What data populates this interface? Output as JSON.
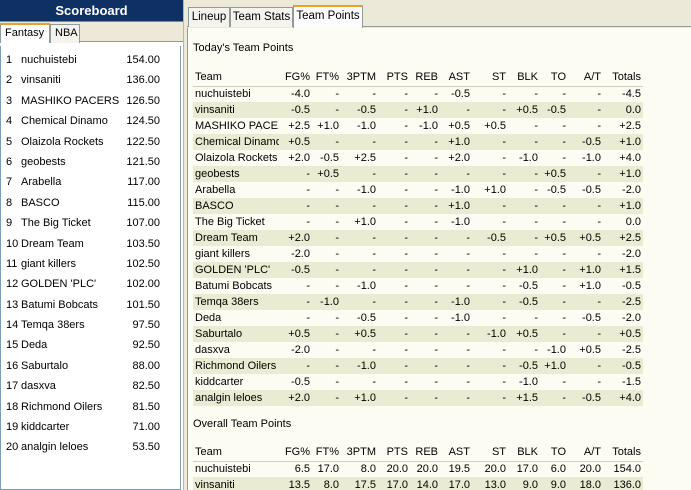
{
  "scoreboard": {
    "title": "Scoreboard",
    "tabs": [
      "Fantasy",
      "NBA"
    ],
    "rows": [
      {
        "rank": "1",
        "name": "nuchuistebi",
        "points": "154.00"
      },
      {
        "rank": "2",
        "name": "vinsaniti",
        "points": "136.00"
      },
      {
        "rank": "3",
        "name": "MASHIKO PACERS",
        "points": "126.50"
      },
      {
        "rank": "4",
        "name": "Chemical Dinamo",
        "points": "124.50"
      },
      {
        "rank": "5",
        "name": "Olaizola Rockets",
        "points": "122.50"
      },
      {
        "rank": "6",
        "name": "geobests",
        "points": "121.50"
      },
      {
        "rank": "7",
        "name": "Arabella",
        "points": "117.00"
      },
      {
        "rank": "8",
        "name": "BASCO",
        "points": "115.00"
      },
      {
        "rank": "9",
        "name": "The Big Ticket",
        "points": "107.00"
      },
      {
        "rank": "10",
        "name": "Dream Team",
        "points": "103.50"
      },
      {
        "rank": "11",
        "name": "giant killers",
        "points": "102.50"
      },
      {
        "rank": "12",
        "name": "GOLDEN 'PLC'",
        "points": "102.00"
      },
      {
        "rank": "13",
        "name": "Batumi Bobcats",
        "points": "101.50"
      },
      {
        "rank": "14",
        "name": "Temqa 38ers",
        "points": "97.50"
      },
      {
        "rank": "15",
        "name": "Deda",
        "points": "92.50"
      },
      {
        "rank": "16",
        "name": "Saburtalo",
        "points": "88.00"
      },
      {
        "rank": "17",
        "name": "dasxva",
        "points": "82.50"
      },
      {
        "rank": "18",
        "name": "Richmond Oilers",
        "points": "81.50"
      },
      {
        "rank": "19",
        "name": "kiddcarter",
        "points": "71.00"
      },
      {
        "rank": "20",
        "name": "analgin leloes",
        "points": "53.50"
      }
    ]
  },
  "main_tabs": {
    "lineup": "Lineup",
    "team_stats": "Team Stats",
    "team_points": "Team Points"
  },
  "today": {
    "title": "Today's Team Points",
    "headers": [
      "Team",
      "FG%",
      "FT%",
      "3PTM",
      "PTS",
      "REB",
      "AST",
      "ST",
      "BLK",
      "TO",
      "A/T",
      "Totals"
    ],
    "rows": [
      [
        "nuchuistebi",
        "-4.0",
        "-",
        "-",
        "-",
        "-",
        "-0.5",
        "-",
        "-",
        "-",
        "-",
        "-4.5"
      ],
      [
        "vinsaniti",
        "-0.5",
        "-",
        "-0.5",
        "-",
        "+1.0",
        "-",
        "-",
        "+0.5",
        "-0.5",
        "-",
        "0.0"
      ],
      [
        "MASHIKO PACE...",
        "+2.5",
        "+1.0",
        "-1.0",
        "-",
        "-1.0",
        "+0.5",
        "+0.5",
        "-",
        "-",
        "-",
        "+2.5"
      ],
      [
        "Chemical Dinamo",
        "+0.5",
        "-",
        "-",
        "-",
        "-",
        "+1.0",
        "-",
        "-",
        "-",
        "-0.5",
        "+1.0"
      ],
      [
        "Olaizola Rockets",
        "+2.0",
        "-0.5",
        "+2.5",
        "-",
        "-",
        "+2.0",
        "-",
        "-1.0",
        "-",
        "-1.0",
        "+4.0"
      ],
      [
        "geobests",
        "-",
        "+0.5",
        "-",
        "-",
        "-",
        "-",
        "-",
        "-",
        "+0.5",
        "-",
        "+1.0"
      ],
      [
        "Arabella",
        "-",
        "-",
        "-1.0",
        "-",
        "-",
        "-1.0",
        "+1.0",
        "-",
        "-0.5",
        "-0.5",
        "-2.0"
      ],
      [
        "BASCO",
        "-",
        "-",
        "-",
        "-",
        "-",
        "+1.0",
        "-",
        "-",
        "-",
        "-",
        "+1.0"
      ],
      [
        "The Big Ticket",
        "-",
        "-",
        "+1.0",
        "-",
        "-",
        "-1.0",
        "-",
        "-",
        "-",
        "-",
        "0.0"
      ],
      [
        "Dream Team",
        "+2.0",
        "-",
        "-",
        "-",
        "-",
        "-",
        "-0.5",
        "-",
        "+0.5",
        "+0.5",
        "+2.5"
      ],
      [
        "giant killers",
        "-2.0",
        "-",
        "-",
        "-",
        "-",
        "-",
        "-",
        "-",
        "-",
        "-",
        "-2.0"
      ],
      [
        "GOLDEN 'PLC'",
        "-0.5",
        "-",
        "-",
        "-",
        "-",
        "-",
        "-",
        "+1.0",
        "-",
        "+1.0",
        "+1.5"
      ],
      [
        "Batumi Bobcats",
        "-",
        "-",
        "-1.0",
        "-",
        "-",
        "-",
        "-",
        "-0.5",
        "-",
        "+1.0",
        "-0.5"
      ],
      [
        "Temqa 38ers",
        "-",
        "-1.0",
        "-",
        "-",
        "-",
        "-1.0",
        "-",
        "-0.5",
        "-",
        "-",
        "-2.5"
      ],
      [
        "Deda",
        "-",
        "-",
        "-0.5",
        "-",
        "-",
        "-1.0",
        "-",
        "-",
        "-",
        "-0.5",
        "-2.0"
      ],
      [
        "Saburtalo",
        "+0.5",
        "-",
        "+0.5",
        "-",
        "-",
        "-",
        "-1.0",
        "+0.5",
        "-",
        "-",
        "+0.5"
      ],
      [
        "dasxva",
        "-2.0",
        "-",
        "-",
        "-",
        "-",
        "-",
        "-",
        "-",
        "-1.0",
        "+0.5",
        "-2.5"
      ],
      [
        "Richmond Oilers",
        "-",
        "-",
        "-1.0",
        "-",
        "-",
        "-",
        "-",
        "-0.5",
        "+1.0",
        "-",
        "-0.5"
      ],
      [
        "kiddcarter",
        "-0.5",
        "-",
        "-",
        "-",
        "-",
        "-",
        "-",
        "-1.0",
        "-",
        "-",
        "-1.5"
      ],
      [
        "analgin leloes",
        "+2.0",
        "-",
        "+1.0",
        "-",
        "-",
        "-",
        "-",
        "+1.5",
        "-",
        "-0.5",
        "+4.0"
      ]
    ]
  },
  "overall": {
    "title": "Overall Team Points",
    "headers": [
      "Team",
      "FG%",
      "FT%",
      "3PTM",
      "PTS",
      "REB",
      "AST",
      "ST",
      "BLK",
      "TO",
      "A/T",
      "Totals"
    ],
    "rows": [
      [
        "nuchuistebi",
        "6.5",
        "17.0",
        "8.0",
        "20.0",
        "20.0",
        "19.5",
        "20.0",
        "17.0",
        "6.0",
        "20.0",
        "154.0"
      ],
      [
        "vinsaniti",
        "13.5",
        "8.0",
        "17.5",
        "17.0",
        "14.0",
        "17.0",
        "13.0",
        "9.0",
        "9.0",
        "18.0",
        "136.0"
      ]
    ]
  }
}
